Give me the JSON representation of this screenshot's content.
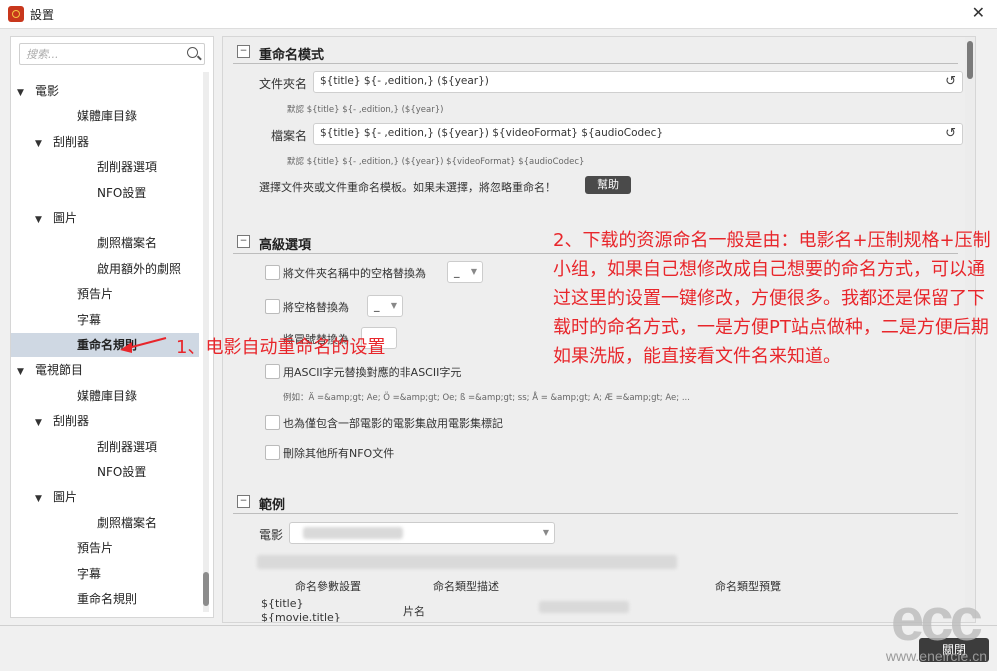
{
  "window": {
    "title": "設置"
  },
  "sidebar": {
    "search_placeholder": "搜索...",
    "items": [
      {
        "label": "電影",
        "level": 0,
        "arrow": "▼"
      },
      {
        "label": "媒體庫目錄",
        "level": 2,
        "arrow": ""
      },
      {
        "label": "刮削器",
        "level": 1,
        "arrow": "▼"
      },
      {
        "label": "刮削器選項",
        "level": 3,
        "arrow": ""
      },
      {
        "label": "NFO設置",
        "level": 3,
        "arrow": ""
      },
      {
        "label": "圖片",
        "level": 1,
        "arrow": "▼"
      },
      {
        "label": "劇照檔案名",
        "level": 3,
        "arrow": ""
      },
      {
        "label": "啟用額外的劇照",
        "level": 3,
        "arrow": ""
      },
      {
        "label": "預告片",
        "level": 2,
        "arrow": ""
      },
      {
        "label": "字幕",
        "level": 2,
        "arrow": ""
      },
      {
        "label": "重命名規則",
        "level": 2,
        "arrow": "",
        "selected": true
      },
      {
        "label": "電視節目",
        "level": 0,
        "arrow": "▼"
      },
      {
        "label": "媒體庫目錄",
        "level": 2,
        "arrow": ""
      },
      {
        "label": "刮削器",
        "level": 1,
        "arrow": "▼"
      },
      {
        "label": "刮削器選項",
        "level": 3,
        "arrow": ""
      },
      {
        "label": "NFO設置",
        "level": 3,
        "arrow": ""
      },
      {
        "label": "圖片",
        "level": 1,
        "arrow": "▼"
      },
      {
        "label": "劇照檔案名",
        "level": 3,
        "arrow": ""
      },
      {
        "label": "預告片",
        "level": 2,
        "arrow": ""
      },
      {
        "label": "字幕",
        "level": 2,
        "arrow": ""
      },
      {
        "label": "重命名規則",
        "level": 2,
        "arrow": ""
      }
    ]
  },
  "rename": {
    "section_title": "重命名模式",
    "folder_label": "文件夾名",
    "folder_value": "${title} ${- ,edition,} (${year})",
    "folder_default": "默認  ${title} ${- ,edition,} (${year})",
    "file_label": "檔案名",
    "file_value": "${title} ${- ,edition,} (${year}) ${videoFormat} ${audioCodec}",
    "file_default": "默認  ${title} ${- ,edition,} (${year}) ${videoFormat} ${audioCodec}",
    "hint": "選擇文件夾或文件重命名模板。如果未選擇，將忽略重命名！",
    "help_label": "幫助"
  },
  "advanced": {
    "section_title": "高級選項",
    "opt1": "將文件夾名稱中的空格替換為",
    "opt1_value": "_",
    "opt2": "將空格替換為",
    "opt2_value": "_",
    "opt3": "將冒號替換為",
    "opt4": "用ASCII字元替換對應的非ASCII字元",
    "example": "例如：Ä =&amp;gt; Ae; Ö =&amp;gt; Oe; ß =&amp;gt; ss; Å = &amp;gt; A; Æ =&amp;gt; Ae; ...",
    "opt5": "也為僅包含一部電影的電影集啟用電影集標記",
    "opt6": "刪除其他所有NFO文件"
  },
  "example_section": {
    "section_title": "範例",
    "movie_label": "電影",
    "col1": "命名參數設置",
    "col2": "命名類型描述",
    "col3": "命名類型預覽",
    "row1": "${title}",
    "row2": "${movie.title}",
    "row_desc": "片名"
  },
  "annotations": {
    "note1": "1、电影自动重命名的设置",
    "note2": "2、下载的资源命名一般是由：电影名+压制规格+压制小组，如果自己想修改成自己想要的命名方式，可以通过这里的设置一键修改，方便很多。我都还是保留了下载时的命名方式，一是方便PT站点做种，二是方便后期如果洗版，能直接看文件名来知道。"
  },
  "footer": {
    "close_label": "關閉"
  },
  "watermark": {
    "logo": "ecc",
    "url": "www.eneircle.cn"
  }
}
